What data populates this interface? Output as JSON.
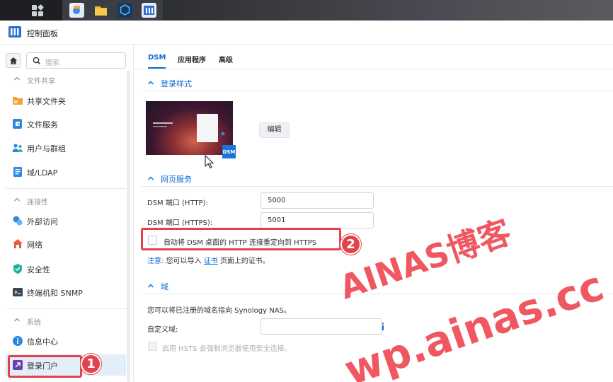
{
  "window": {
    "title": "控制面板"
  },
  "search": {
    "placeholder": "搜索"
  },
  "sidebar": {
    "groups": [
      {
        "label": "文件共享",
        "items": [
          "共享文件夹",
          "文件服务",
          "用户与群组",
          "域/LDAP"
        ]
      },
      {
        "label": "连接性",
        "items": [
          "外部访问",
          "网络",
          "安全性",
          "终端机和 SNMP"
        ]
      },
      {
        "label": "系统",
        "items": [
          "信息中心",
          "登录门户"
        ]
      }
    ],
    "active_item": "登录门户"
  },
  "tabs": [
    "DSM",
    "应用程序",
    "高级"
  ],
  "sections": {
    "login_style": {
      "title": "登录样式",
      "edit_button": "编辑",
      "preview_badge": "DSM"
    },
    "web_services": {
      "title": "网页服务",
      "http_label": "DSM 端口 (HTTP):",
      "http_value": "5000",
      "https_label": "DSM 端口 (HTTPS):",
      "https_value": "5001",
      "redirect_label": "自动将 DSM 桌面的 HTTP 连接重定向到 HTTPS",
      "note_tag": "注意:",
      "note_before": "您可以导入",
      "note_link": "证书",
      "note_after": "页面上的证书。"
    },
    "domain": {
      "title": "域",
      "description": "您可以将已注册的域名指向 Synology NAS。",
      "custom_domain_label": "自定义域:",
      "hsts_label": "启用 HSTS 会强制浏览器使用安全连接。"
    }
  },
  "annotations": {
    "badge1": "1",
    "badge2": "2"
  },
  "watermark": {
    "line1": "AINAS博客",
    "line2": "wp.ainas.cc"
  },
  "colors": {
    "accent": "#0b6bd6",
    "annotation_red": "#e2434b",
    "active_bg": "#e3eefb"
  }
}
